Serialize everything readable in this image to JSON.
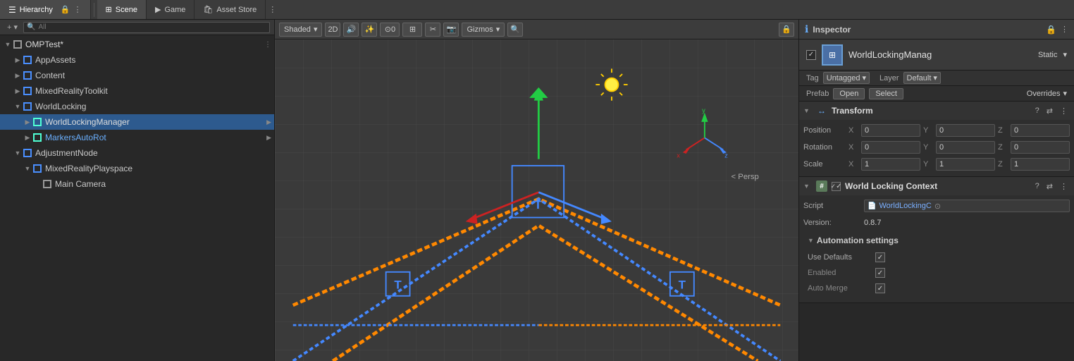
{
  "hierarchy": {
    "title": "Hierarchy",
    "search_placeholder": "All",
    "root": "OMPTest*",
    "items": [
      {
        "label": "AppAssets",
        "depth": 1,
        "type": "cube-blue",
        "arrow": "closed",
        "id": "app-assets"
      },
      {
        "label": "Content",
        "depth": 1,
        "type": "cube-blue",
        "arrow": "closed",
        "id": "content"
      },
      {
        "label": "MixedRealityToolkit",
        "depth": 1,
        "type": "cube-blue",
        "arrow": "closed",
        "id": "mrt"
      },
      {
        "label": "WorldLocking",
        "depth": 1,
        "type": "cube-blue",
        "arrow": "open",
        "id": "world-locking"
      },
      {
        "label": "WorldLockingManager",
        "depth": 2,
        "type": "cube-teal",
        "arrow": "closed",
        "selected": true,
        "has_arrow_right": true,
        "id": "wlm"
      },
      {
        "label": "MarkersAutoRot",
        "depth": 2,
        "type": "cube-teal",
        "arrow": "closed",
        "has_arrow_right": true,
        "id": "mar"
      },
      {
        "label": "AdjustmentNode",
        "depth": 1,
        "type": "cube-blue",
        "arrow": "open",
        "id": "adj-node"
      },
      {
        "label": "MixedRealityPlayspace",
        "depth": 2,
        "type": "cube-blue",
        "arrow": "open",
        "id": "mrp"
      },
      {
        "label": "Main Camera",
        "depth": 3,
        "type": "cube-gray",
        "arrow": "leaf",
        "id": "main-camera"
      }
    ]
  },
  "scene_tabs": [
    {
      "label": "Scene",
      "active": true,
      "icon": "⊞"
    },
    {
      "label": "Game",
      "active": false,
      "icon": "▶"
    },
    {
      "label": "Asset Store",
      "active": false,
      "icon": "🛍"
    }
  ],
  "scene_toolbar": {
    "shading": "Shaded",
    "mode_2d": "2D",
    "gizmos": "Gizmos"
  },
  "inspector": {
    "title": "Inspector",
    "object_name": "WorldLockingManag",
    "static_label": "Static",
    "tag_label": "Tag",
    "tag_value": "Untagged",
    "layer_label": "Layer",
    "layer_value": "Default",
    "prefab_label": "Prefab",
    "prefab_open": "Open",
    "prefab_select": "Select",
    "prefab_overrides": "Overrides",
    "transform": {
      "title": "Transform",
      "position_label": "Position",
      "rotation_label": "Rotation",
      "scale_label": "Scale",
      "pos_x": "0",
      "pos_y": "0",
      "pos_z": "0",
      "rot_x": "0",
      "rot_y": "0",
      "rot_z": "0",
      "scale_x": "1",
      "scale_y": "1",
      "scale_z": "1"
    },
    "wlc": {
      "title": "World Locking Context",
      "script_label": "Script",
      "script_value": "WorldLockingC",
      "version_label": "Version:",
      "version_value": "0.8.7",
      "automation_label": "Automation settings",
      "use_defaults_label": "Use Defaults",
      "use_defaults_checked": true,
      "enabled_label": "Enabled",
      "enabled_checked": true,
      "auto_merge_label": "Auto Merge",
      "auto_merge_checked": true
    }
  }
}
